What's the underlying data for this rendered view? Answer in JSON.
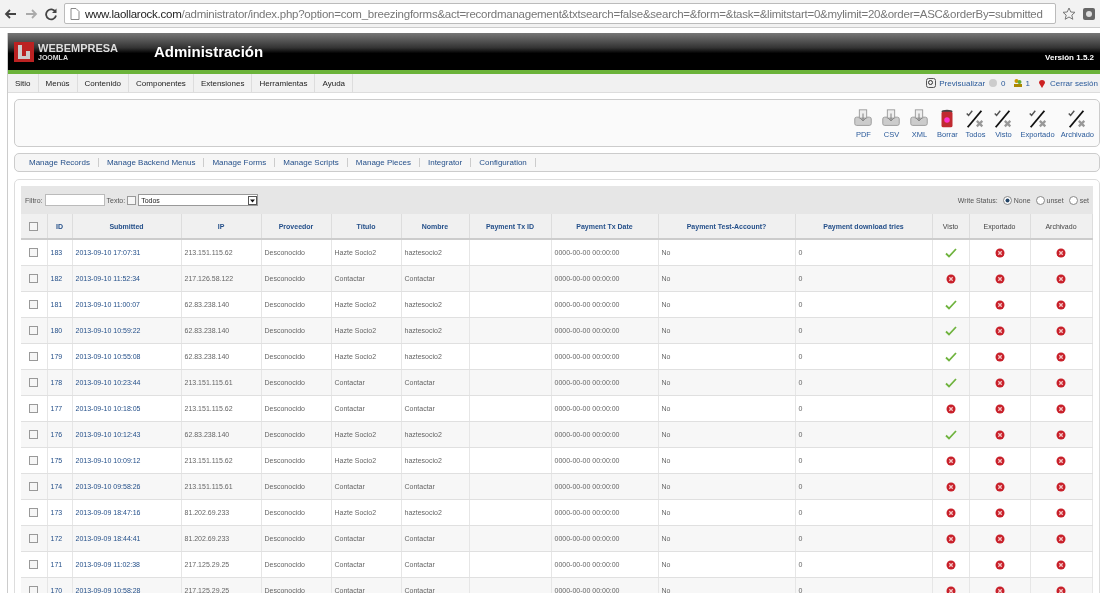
{
  "browser": {
    "url_host": "www.laollarock.com",
    "url_path": "/administrator/index.php?option=com_breezingforms&act=recordmanagement&txtsearch=false&search=&form=&task=&limitstart=0&mylimit=20&order=ASC&orderBy=submitted"
  },
  "header": {
    "brand": "WEBEMPRESA",
    "brand_sub": "JOOMLA",
    "title": "Administración",
    "version": "Versión 1.5.2"
  },
  "menu": [
    "Sitio",
    "Menús",
    "Contenido",
    "Componentes",
    "Extensiones",
    "Herramientas",
    "Ayuda"
  ],
  "status": {
    "preview": "Previsualizar",
    "messages": "0",
    "users": "1",
    "logout": "Cerrar sesión"
  },
  "toolbar": [
    {
      "kind": "printer",
      "label": "PDF"
    },
    {
      "kind": "printer",
      "label": "CSV"
    },
    {
      "kind": "printer",
      "label": "XML"
    },
    {
      "kind": "trash",
      "label": "Borrar"
    },
    {
      "kind": "toggle",
      "label": "Todos"
    },
    {
      "kind": "toggle",
      "label": "Visto"
    },
    {
      "kind": "toggle",
      "label": "Exportado"
    },
    {
      "kind": "toggle",
      "label": "Archivado"
    }
  ],
  "submenu": [
    "Manage Records",
    "Manage Backend Menus",
    "Manage Forms",
    "Manage Scripts",
    "Manage Pieces",
    "Integrator",
    "Configuration"
  ],
  "filter": {
    "filter_label": "Filtro:",
    "text_label": "Texto:",
    "text_checked": false,
    "select_value": "Todos",
    "write_status_label": "Write Status:",
    "options": [
      {
        "label": "None",
        "selected": true
      },
      {
        "label": "unset",
        "selected": false
      },
      {
        "label": "set",
        "selected": false
      }
    ]
  },
  "all_checked": false,
  "columns": [
    "ID",
    "Submitted",
    "IP",
    "Proveedor",
    "Título",
    "Nombre",
    "Payment Tx ID",
    "Payment Tx Date",
    "Payment Test-Account?",
    "Payment download tries",
    "Visto",
    "Exportado",
    "Archivado"
  ],
  "rows": [
    {
      "checked": false,
      "id": "183",
      "submitted": "2013-09-10 17:07:31",
      "ip": "213.151.115.62",
      "provider": "Desconocido",
      "title": "Hazte Socio2",
      "name": "haztesocio2",
      "tx_date": "0000-00-00 00:00:00",
      "test": "No",
      "tries": "0",
      "viewed": true,
      "exported": false,
      "archived": false
    },
    {
      "checked": false,
      "id": "182",
      "submitted": "2013-09-10 11:52:34",
      "ip": "217.126.58.122",
      "provider": "Desconocido",
      "title": "Contactar",
      "name": "Contactar",
      "tx_date": "0000-00-00 00:00:00",
      "test": "No",
      "tries": "0",
      "viewed": false,
      "exported": false,
      "archived": false
    },
    {
      "checked": false,
      "id": "181",
      "submitted": "2013-09-10 11:00:07",
      "ip": "62.83.238.140",
      "provider": "Desconocido",
      "title": "Hazte Socio2",
      "name": "haztesocio2",
      "tx_date": "0000-00-00 00:00:00",
      "test": "No",
      "tries": "0",
      "viewed": true,
      "exported": false,
      "archived": false
    },
    {
      "checked": false,
      "id": "180",
      "submitted": "2013-09-10 10:59:22",
      "ip": "62.83.238.140",
      "provider": "Desconocido",
      "title": "Hazte Socio2",
      "name": "haztesocio2",
      "tx_date": "0000-00-00 00:00:00",
      "test": "No",
      "tries": "0",
      "viewed": true,
      "exported": false,
      "archived": false
    },
    {
      "checked": false,
      "id": "179",
      "submitted": "2013-09-10 10:55:08",
      "ip": "62.83.238.140",
      "provider": "Desconocido",
      "title": "Hazte Socio2",
      "name": "haztesocio2",
      "tx_date": "0000-00-00 00:00:00",
      "test": "No",
      "tries": "0",
      "viewed": true,
      "exported": false,
      "archived": false
    },
    {
      "checked": false,
      "id": "178",
      "submitted": "2013-09-10 10:23:44",
      "ip": "213.151.115.61",
      "provider": "Desconocido",
      "title": "Contactar",
      "name": "Contactar",
      "tx_date": "0000-00-00 00:00:00",
      "test": "No",
      "tries": "0",
      "viewed": true,
      "exported": false,
      "archived": false
    },
    {
      "checked": false,
      "id": "177",
      "submitted": "2013-09-10 10:18:05",
      "ip": "213.151.115.62",
      "provider": "Desconocido",
      "title": "Contactar",
      "name": "Contactar",
      "tx_date": "0000-00-00 00:00:00",
      "test": "No",
      "tries": "0",
      "viewed": false,
      "exported": false,
      "archived": false
    },
    {
      "checked": false,
      "id": "176",
      "submitted": "2013-09-10 10:12:43",
      "ip": "62.83.238.140",
      "provider": "Desconocido",
      "title": "Hazte Socio2",
      "name": "haztesocio2",
      "tx_date": "0000-00-00 00:00:00",
      "test": "No",
      "tries": "0",
      "viewed": true,
      "exported": false,
      "archived": false
    },
    {
      "checked": false,
      "id": "175",
      "submitted": "2013-09-10 10:09:12",
      "ip": "213.151.115.62",
      "provider": "Desconocido",
      "title": "Hazte Socio2",
      "name": "haztesocio2",
      "tx_date": "0000-00-00 00:00:00",
      "test": "No",
      "tries": "0",
      "viewed": false,
      "exported": false,
      "archived": false
    },
    {
      "checked": false,
      "id": "174",
      "submitted": "2013-09-10 09:58:26",
      "ip": "213.151.115.61",
      "provider": "Desconocido",
      "title": "Contactar",
      "name": "Contactar",
      "tx_date": "0000-00-00 00:00:00",
      "test": "No",
      "tries": "0",
      "viewed": false,
      "exported": false,
      "archived": false
    },
    {
      "checked": false,
      "id": "173",
      "submitted": "2013-09-09 18:47:16",
      "ip": "81.202.69.233",
      "provider": "Desconocido",
      "title": "Hazte Socio2",
      "name": "haztesocio2",
      "tx_date": "0000-00-00 00:00:00",
      "test": "No",
      "tries": "0",
      "viewed": false,
      "exported": false,
      "archived": false
    },
    {
      "checked": false,
      "id": "172",
      "submitted": "2013-09-09 18:44:41",
      "ip": "81.202.69.233",
      "provider": "Desconocido",
      "title": "Contactar",
      "name": "Contactar",
      "tx_date": "0000-00-00 00:00:00",
      "test": "No",
      "tries": "0",
      "viewed": false,
      "exported": false,
      "archived": false
    },
    {
      "checked": false,
      "id": "171",
      "submitted": "2013-09-09 11:02:38",
      "ip": "217.125.29.25",
      "provider": "Desconocido",
      "title": "Contactar",
      "name": "Contactar",
      "tx_date": "0000-00-00 00:00:00",
      "test": "No",
      "tries": "0",
      "viewed": false,
      "exported": false,
      "archived": false
    },
    {
      "checked": false,
      "id": "170",
      "submitted": "2013-09-09 10:58:28",
      "ip": "217.125.29.25",
      "provider": "Desconocido",
      "title": "Contactar",
      "name": "Contactar",
      "tx_date": "0000-00-00 00:00:00",
      "test": "No",
      "tries": "0",
      "viewed": false,
      "exported": false,
      "archived": false
    }
  ]
}
